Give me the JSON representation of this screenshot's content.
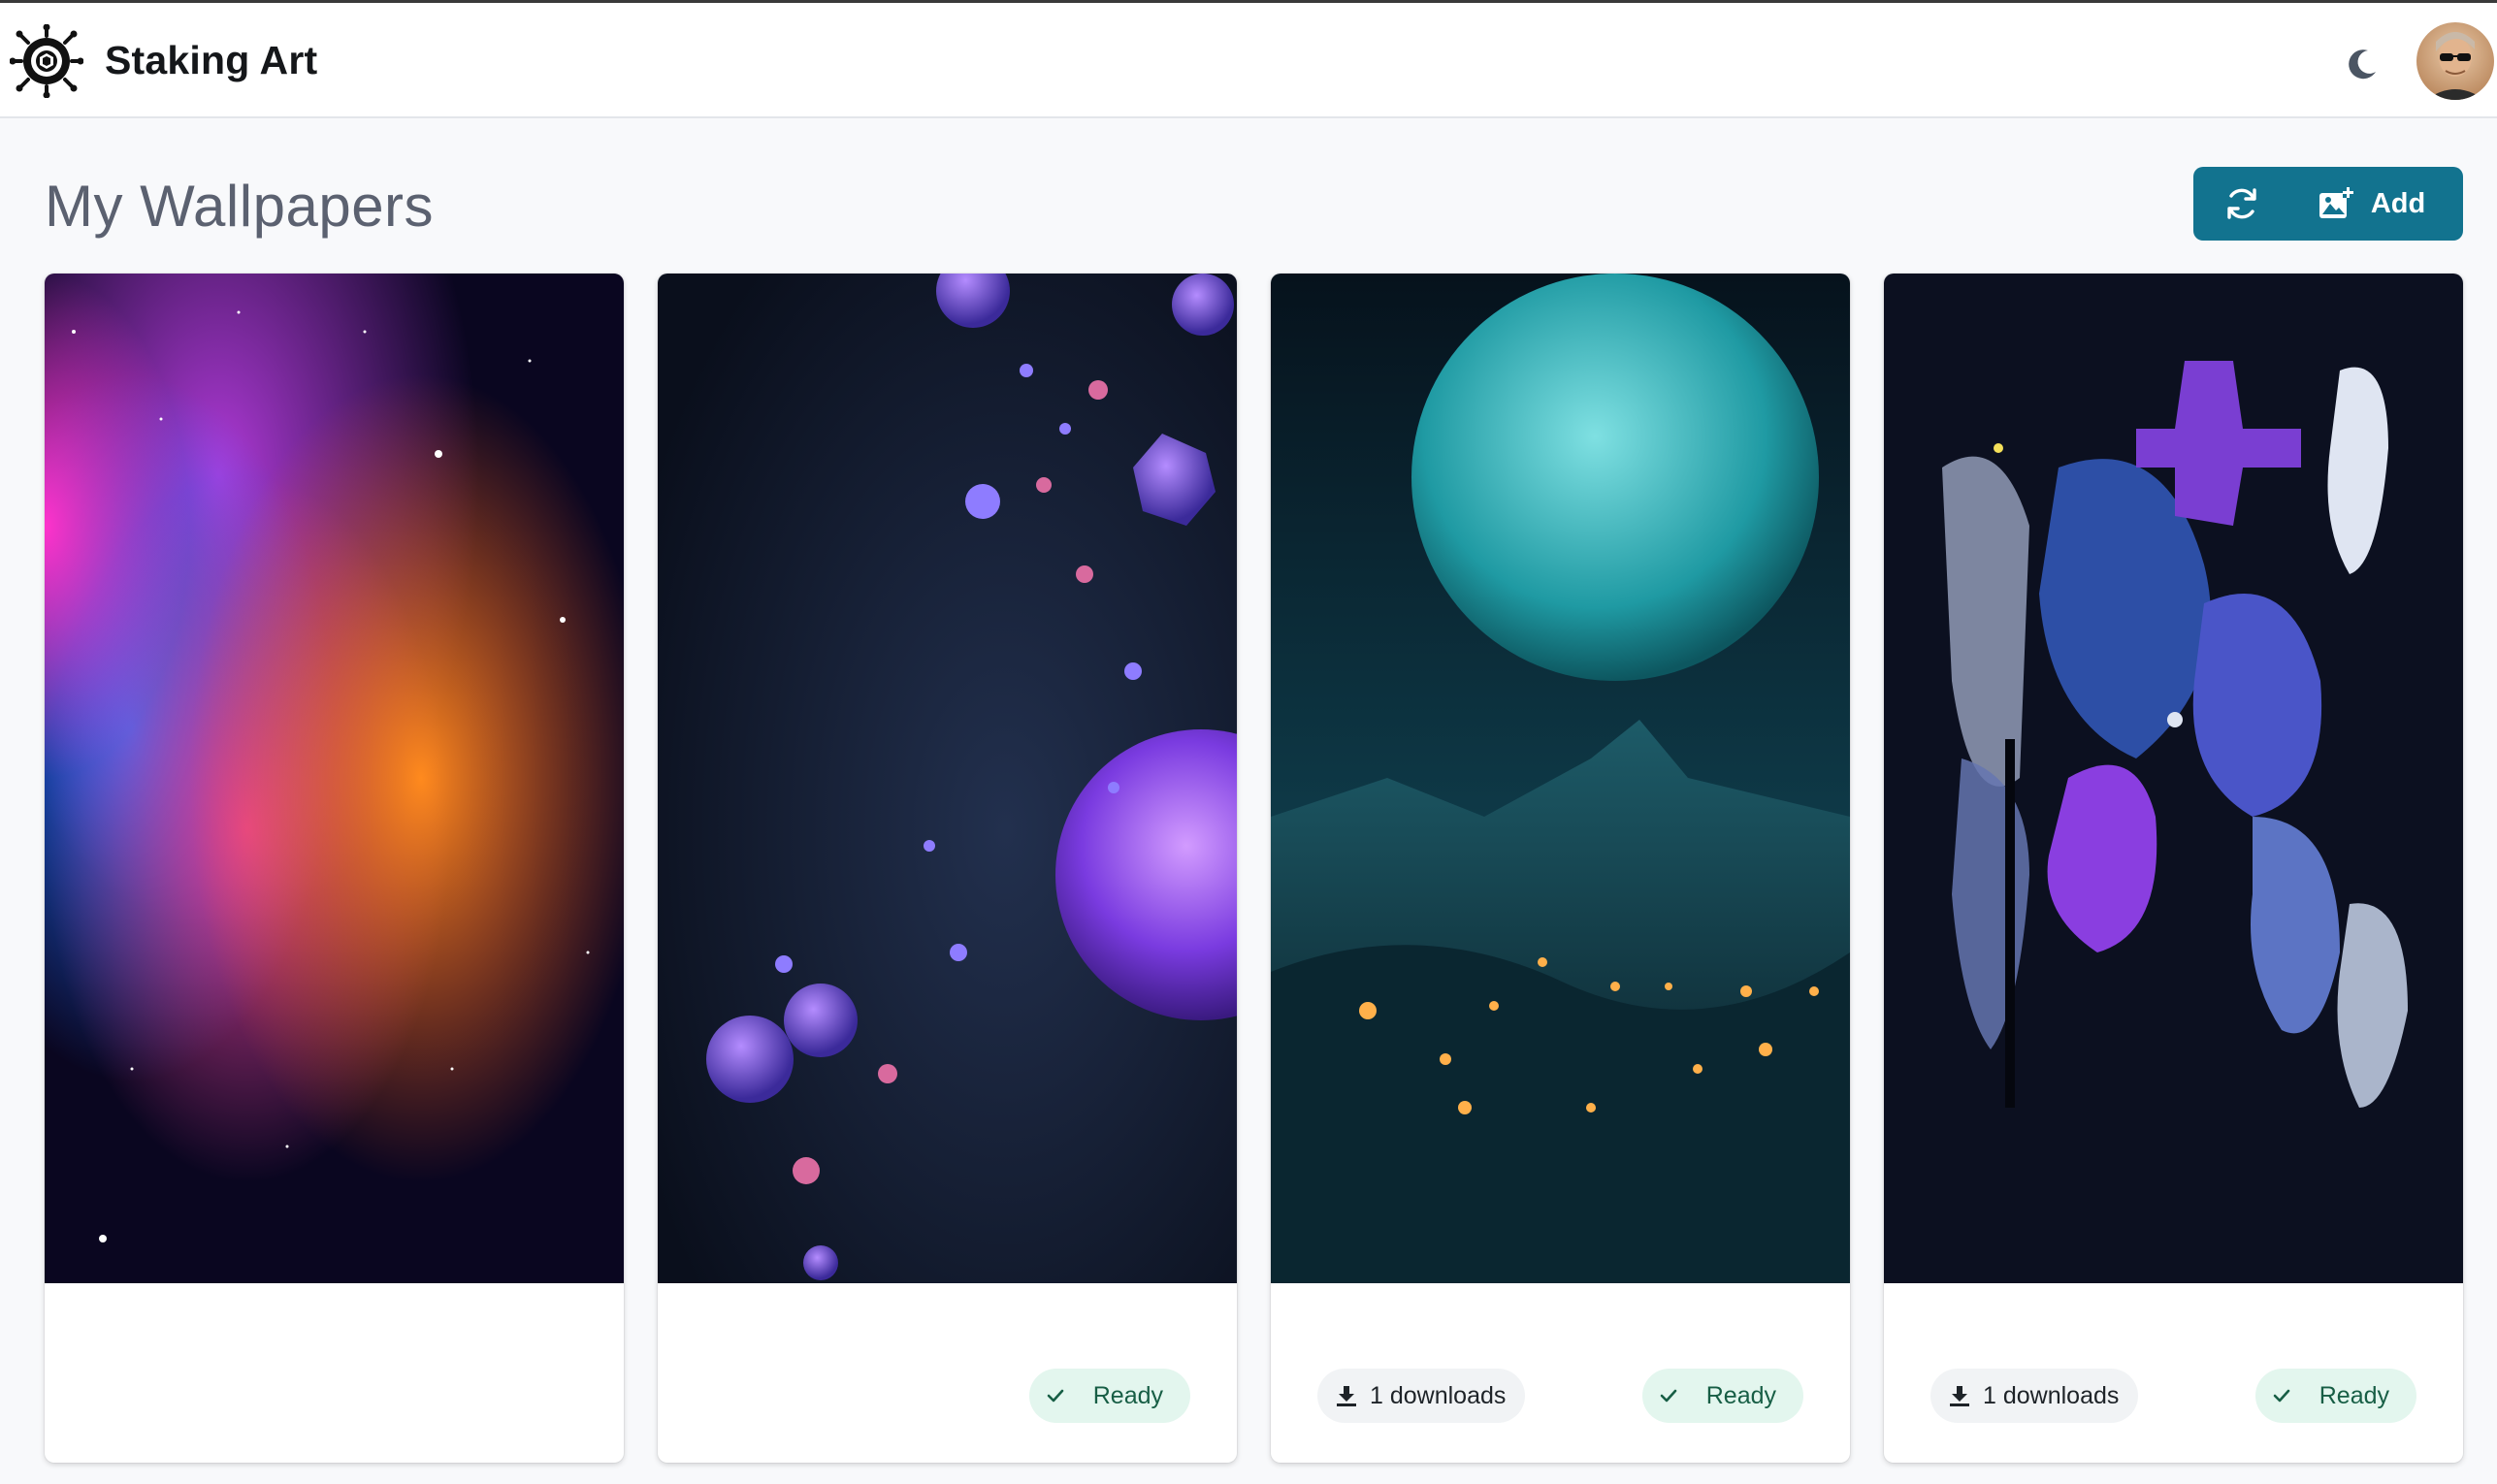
{
  "app": {
    "title": "Staking Art"
  },
  "header": {
    "theme_toggle_icon": "moon-icon",
    "avatar_icon": "user-avatar",
    "logo_icon": "camera-aperture-logo"
  },
  "main": {
    "title": "My Wallpapers",
    "refresh_icon": "refresh-icon",
    "add_label": "Add",
    "add_icon": "add-image-icon",
    "accent": "#12738f"
  },
  "wallpapers": [
    {
      "image": "galaxy-nebula",
      "downloads": "",
      "status": ""
    },
    {
      "image": "purple-molecules",
      "downloads": "",
      "status": "Ready"
    },
    {
      "image": "teal-moon-landscape",
      "downloads": "1 downloads",
      "status": "Ready"
    },
    {
      "image": "blue-paint-splatter",
      "downloads": "1 downloads",
      "status": "Ready"
    }
  ],
  "colors": {
    "ready_bg": "#e3f6ee",
    "ready_text": "#175e45",
    "downloads_bg": "#f1f3f5"
  }
}
